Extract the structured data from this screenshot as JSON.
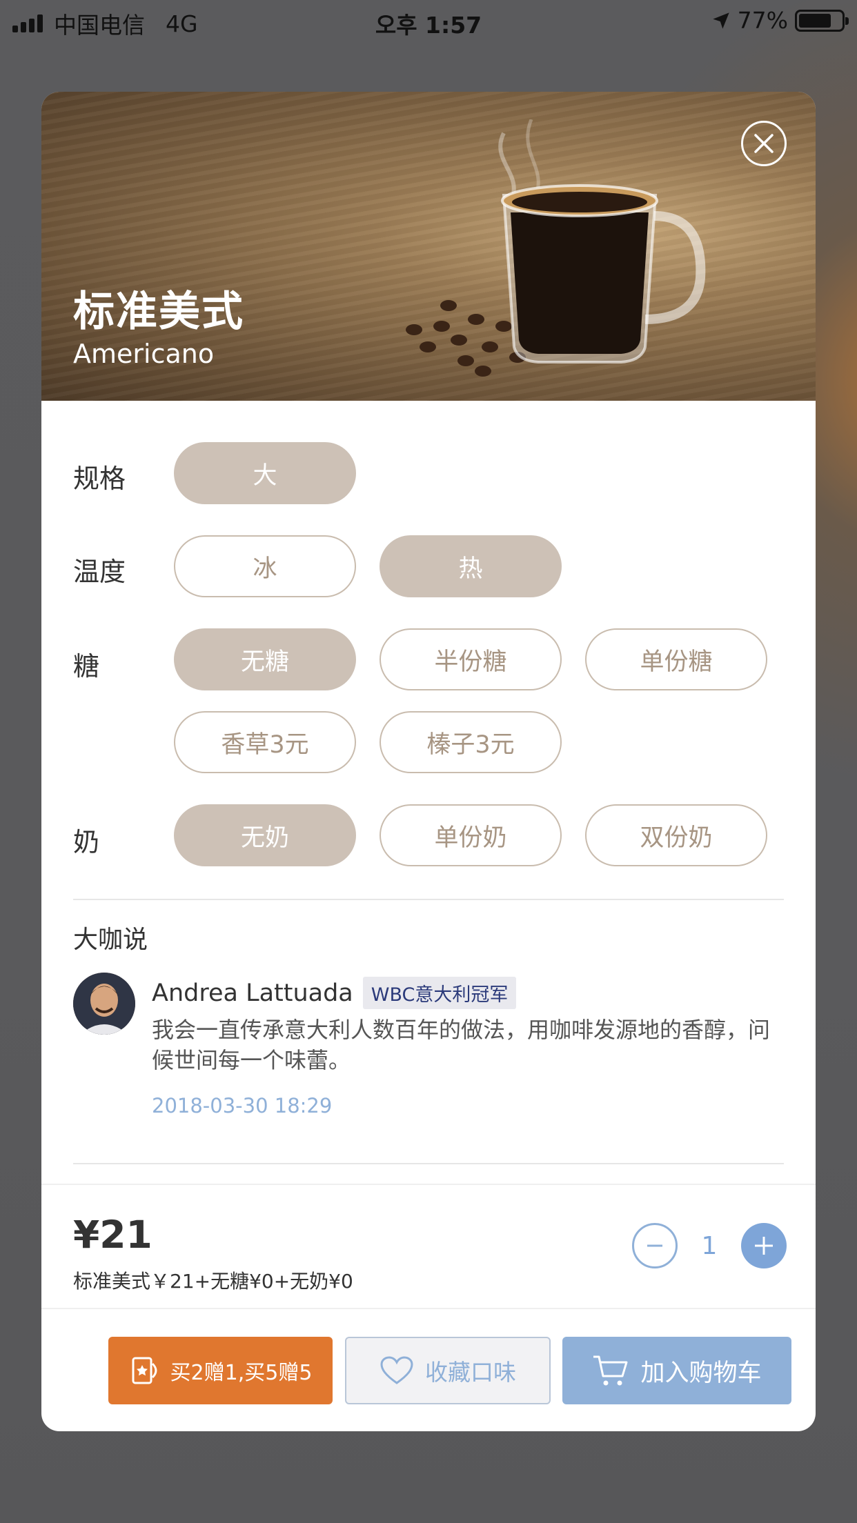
{
  "status_bar": {
    "carrier": "中国电信",
    "network": "4G",
    "time": "오후 1:57",
    "battery": "77%",
    "battery_level": 0.77
  },
  "product": {
    "name_cn": "标准美式",
    "name_en": "Americano"
  },
  "options": {
    "size": {
      "label": "规格",
      "choices": [
        "大"
      ],
      "selected": "大"
    },
    "temperature": {
      "label": "温度",
      "choices": [
        "冰",
        "热"
      ],
      "selected": "热"
    },
    "sugar": {
      "label": "糖",
      "choices": [
        "无糖",
        "半份糖",
        "单份糖",
        "香草3元",
        "榛子3元"
      ],
      "selected": "无糖"
    },
    "milk": {
      "label": "奶",
      "choices": [
        "无奶",
        "单份奶",
        "双份奶"
      ],
      "selected": "无奶"
    }
  },
  "review": {
    "section_title": "大咖说",
    "author": "Andrea Lattuada",
    "badge": "WBC意大利冠军",
    "quote": "我会一直传承意大利人数百年的做法，用咖啡发源地的香醇，问候世间每一个味蕾。",
    "time": "2018-03-30 18:29"
  },
  "order": {
    "price": "¥21",
    "detail": "标准美式￥21+无糖¥0+无奶¥0",
    "quantity": "1"
  },
  "actions": {
    "promo_label": "买2赠1,买5赠5",
    "favorite_label": "收藏口味",
    "cart_label": "加入购物车"
  },
  "colors": {
    "chip_selected": "#cdc1b6",
    "chip_text": "#a79583",
    "accent_blue": "#8fb0d8",
    "promo_orange": "#e0772f"
  }
}
